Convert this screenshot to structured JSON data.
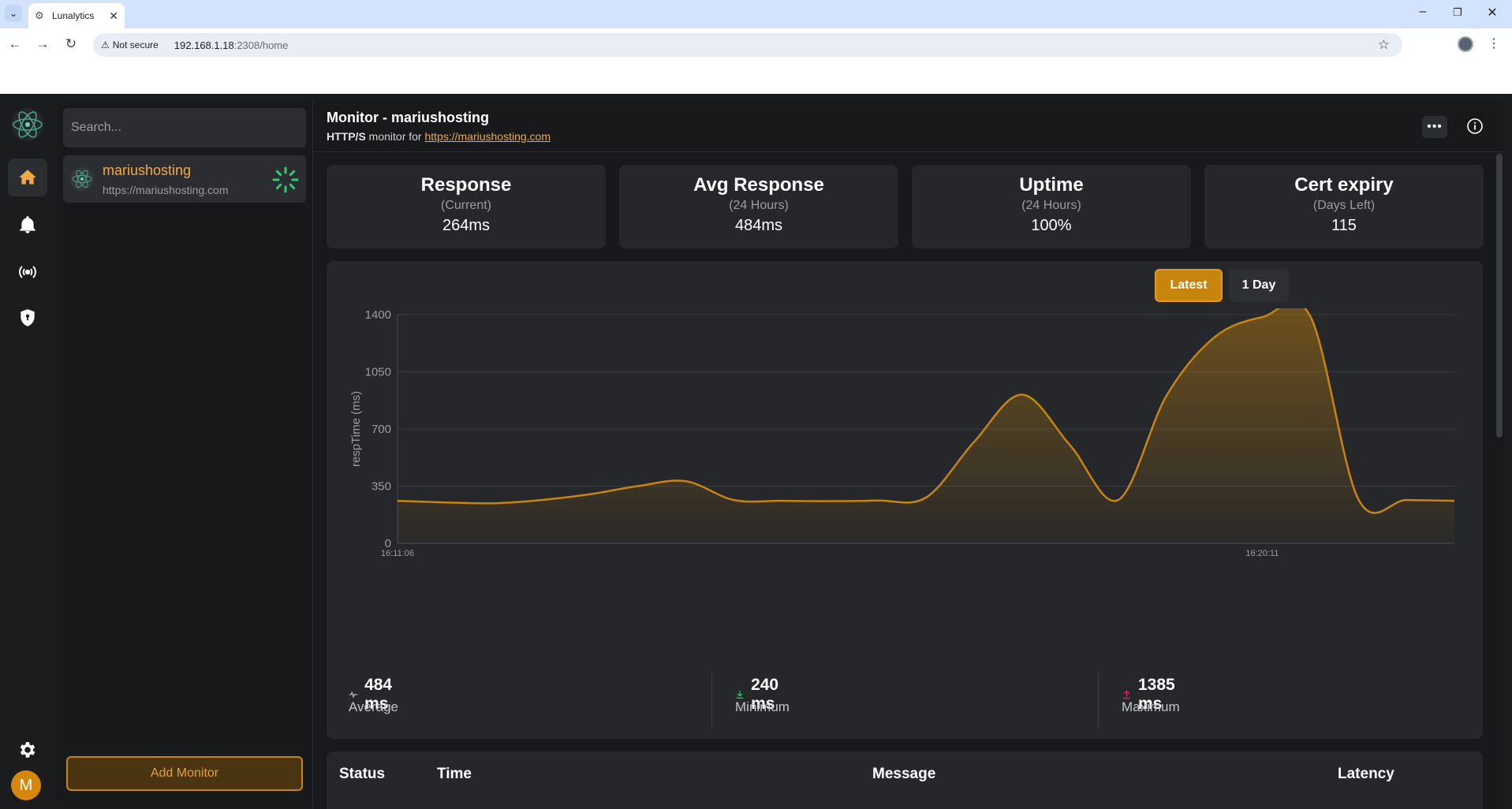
{
  "browser": {
    "tab_title": "Lunalytics",
    "not_secure": "Not secure",
    "url_host": "192.168.1.18",
    "url_path": ":2308/home"
  },
  "sidebar": {
    "search_placeholder": "Search...",
    "monitors": [
      {
        "name": "mariushosting",
        "url": "https://mariushosting.com"
      }
    ],
    "add_button": "Add Monitor",
    "avatar_letter": "M"
  },
  "header": {
    "title": "Monitor - mariushosting",
    "type": "HTTP/S",
    "sub_text": " monitor for ",
    "link": "https://mariushosting.com"
  },
  "stats": [
    {
      "title": "Response",
      "sub": "(Current)",
      "value": "264ms"
    },
    {
      "title": "Avg Response",
      "sub": "(24 Hours)",
      "value": "484ms"
    },
    {
      "title": "Uptime",
      "sub": "(24 Hours)",
      "value": "100%"
    },
    {
      "title": "Cert expiry",
      "sub": "(Days Left)",
      "value": "115"
    }
  ],
  "chart_controls": {
    "latest": "Latest",
    "one_day": "1 Day"
  },
  "chart_data": {
    "type": "area",
    "ylabel": "respTime (ms)",
    "ylim": [
      0,
      1400
    ],
    "yticks": [
      0,
      350,
      700,
      1050,
      1400
    ],
    "xtick_labels": [
      "16:11:06",
      "16:20:11"
    ],
    "xtick_index": [
      0,
      18
    ],
    "color": "#c7850e",
    "grid": true,
    "values": [
      260,
      250,
      245,
      265,
      300,
      350,
      380,
      265,
      260,
      258,
      262,
      280,
      620,
      910,
      600,
      265,
      900,
      1260,
      1385,
      1390,
      270,
      265,
      260
    ]
  },
  "summary": [
    {
      "value": "484 ms",
      "label": "Average",
      "icon": "pulse-icon"
    },
    {
      "value": "240 ms",
      "label": "Minimum",
      "icon": "download-icon"
    },
    {
      "value": "1385 ms",
      "label": "Maximum",
      "icon": "upload-icon"
    }
  ],
  "table": {
    "headers": [
      "Status",
      "Time",
      "Message",
      "Latency"
    ]
  }
}
